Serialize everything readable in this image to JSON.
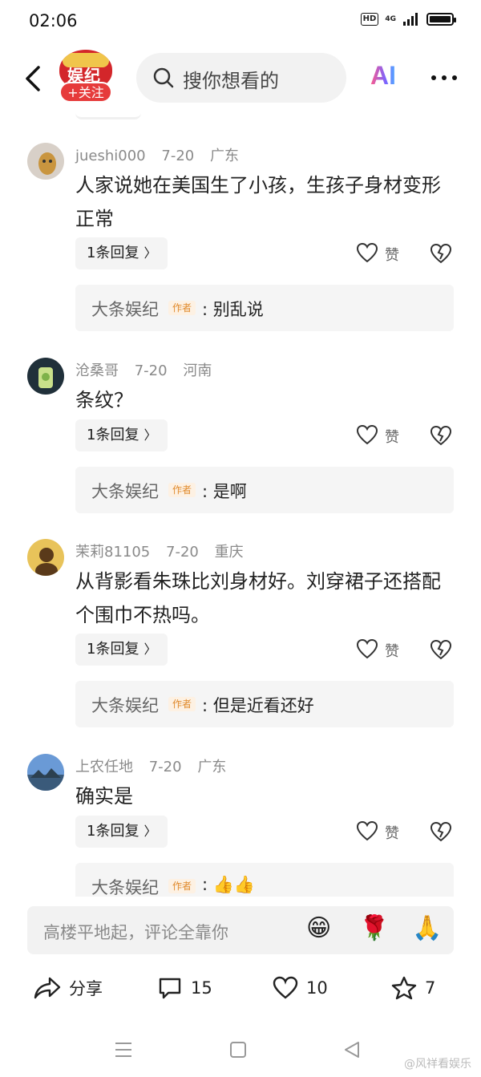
{
  "status_bar": {
    "time": "02:06",
    "hd": "HD",
    "network": "4G"
  },
  "header": {
    "brand_logo_text": "娱纪",
    "follow_label": "+关注",
    "search_placeholder": "搜你想看的",
    "ai_label": "AI"
  },
  "comments": [
    {
      "user": "jueshi000",
      "date": "7-20",
      "location": "广东",
      "text": "人家说她在美国生了小孩，生孩子身材变形正常",
      "reply_count_label": "1条回复",
      "like_label": "赞",
      "author_reply": {
        "name": "大条娱纪",
        "tag": "作者",
        "text": ": 别乱说"
      }
    },
    {
      "user": "沧桑哥",
      "date": "7-20",
      "location": "河南",
      "text": "条纹？",
      "reply_count_label": "1条回复",
      "like_label": "赞",
      "author_reply": {
        "name": "大条娱纪",
        "tag": "作者",
        "text": ": 是啊"
      }
    },
    {
      "user": "茉莉81105",
      "date": "7-20",
      "location": "重庆",
      "text": "从背影看朱珠比刘身材好。刘穿裙子还搭配个围巾不热吗。",
      "reply_count_label": "1条回复",
      "like_label": "赞",
      "author_reply": {
        "name": "大条娱纪",
        "tag": "作者",
        "text": ": 但是近看还好"
      }
    },
    {
      "user": "上农任地",
      "date": "7-20",
      "location": "广东",
      "text": "确实是",
      "reply_count_label": "1条回复",
      "like_label": "赞",
      "author_reply": {
        "name": "大条娱纪",
        "tag": "作者",
        "text": ": 👍👍"
      }
    }
  ],
  "input": {
    "placeholder": "高楼平地起，评论全靠你"
  },
  "emojis": [
    "😁",
    "🌹",
    "🙏"
  ],
  "actions": {
    "share_label": "分享",
    "comment_count": "15",
    "like_count": "10",
    "star_count": "7"
  },
  "watermark": "@风祥看娱乐"
}
